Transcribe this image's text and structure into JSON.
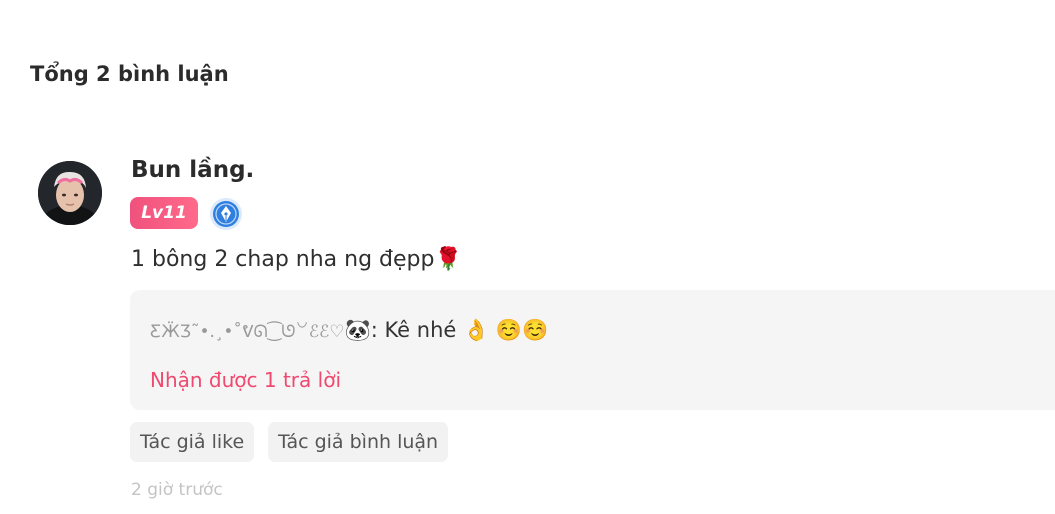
{
  "summary": {
    "total_label": "Tổng 2 bình luận"
  },
  "comment": {
    "avatar_icon": "user-avatar",
    "username": "Bun lầng.",
    "level": "Lv11",
    "verified_icon": "author-pen-badge-icon",
    "text": "1 bông 2 chap nha ng đẹpp🌹",
    "reply": {
      "nickname": "ƸӜƷ˜•.¸•˚ᕓᘏ⁐ᘎ꒡ℰℰ♡",
      "text": "🐼: Kê nhé 👌 ☺️☺️",
      "reply_count_label": "Nhận được 1 trả lời"
    },
    "tags": [
      "Tác giả like",
      "Tác giả bình luận"
    ],
    "time": "2 giờ trước"
  },
  "colors": {
    "accent": "#f0496f",
    "badge": "#f0517e",
    "verified": "#2f7fe0"
  }
}
